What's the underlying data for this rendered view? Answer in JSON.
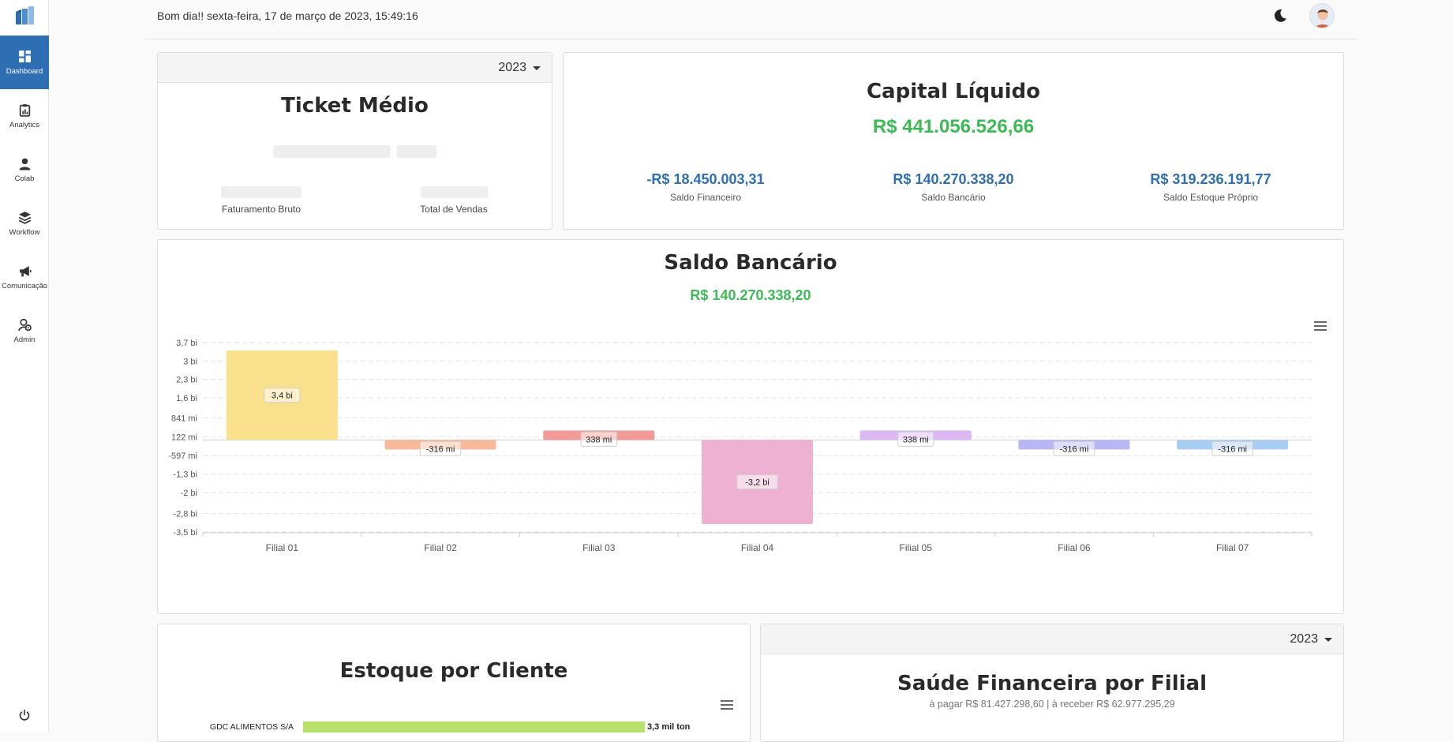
{
  "header": {
    "greeting": "Bom dia!! sexta-feira, 17 de março de 2023, 15:49:16"
  },
  "sidebar": {
    "items": [
      {
        "label": "Dashboard",
        "icon": "dashboard-icon"
      },
      {
        "label": "Analytics",
        "icon": "clipboard-chart-icon"
      },
      {
        "label": "Colab",
        "icon": "user-icon"
      },
      {
        "label": "Workflow",
        "icon": "layers-icon"
      },
      {
        "label": "Comunicação",
        "icon": "megaphone-icon"
      },
      {
        "label": "Admin",
        "icon": "user-gear-icon"
      }
    ],
    "active": "Dashboard"
  },
  "ticket_medio": {
    "year": "2023",
    "title": "Ticket Médio",
    "faturamento_label": "Faturamento Bruto",
    "vendas_label": "Total de Vendas"
  },
  "capital_liquido": {
    "title": "Capital Líquido",
    "total": "R$ 441.056.526,66",
    "items": [
      {
        "value": "-R$ 18.450.003,31",
        "label": "Saldo Financeiro"
      },
      {
        "value": "R$ 140.270.338,20",
        "label": "Saldo Bancário"
      },
      {
        "value": "R$ 319.236.191,77",
        "label": "Saldo Estoque Próprio"
      }
    ]
  },
  "saldo_bancario": {
    "title": "Saldo Bancário",
    "total": "R$ 140.270.338,20"
  },
  "chart_data": {
    "type": "bar",
    "title": "Saldo Bancário",
    "subtitle": "R$ 140.270.338,20",
    "categories": [
      "Filial 01",
      "Filial 02",
      "Filial 03",
      "Filial 04",
      "Filial 05",
      "Filial 06",
      "Filial 07"
    ],
    "values": [
      3400000000,
      -316000000,
      338000000,
      -3200000000,
      338000000,
      -316000000,
      -316000000
    ],
    "data_labels": [
      "3,4 bi",
      "-316 mi",
      "338 mi",
      "-3,2 bi",
      "338 mi",
      "-316 mi",
      "-316 mi"
    ],
    "colors": [
      "#f8e08c",
      "#f6b999",
      "#f19c98",
      "#eeb1d1",
      "#dcb8f3",
      "#b8b6f4",
      "#a9cdf2"
    ],
    "y_ticks": [
      3700000000,
      3000000000,
      2300000000,
      1600000000,
      841000000,
      122000000,
      -597000000,
      -1300000000,
      -2000000000,
      -2800000000,
      -3500000000
    ],
    "y_tick_labels": [
      "3,7 bi",
      "3 bi",
      "2,3 bi",
      "1,6 bi",
      "841 mi",
      "122 mi",
      "-597 mi",
      "-1,3 bi",
      "-2 bi",
      "-2,8 bi",
      "-3,5 bi"
    ],
    "ylim": [
      -3500000000,
      3700000000
    ],
    "grid": true,
    "gridline_style": "dashed"
  },
  "estoque": {
    "title": "Estoque por Cliente",
    "first_client": "GDC ALIMENTOS S/A",
    "first_value": "3,3 mil ton"
  },
  "saude": {
    "year": "2023",
    "title": "Saúde Financeira por Filial",
    "subtitle": "à pagar R$ 81.427.298,60 | à receber R$ 62.977.295,29"
  }
}
